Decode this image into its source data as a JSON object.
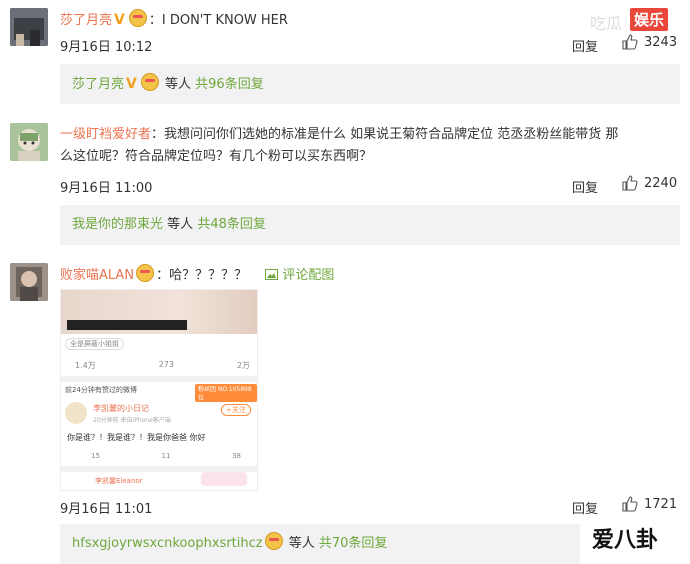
{
  "watermark_top": {
    "text": "娱乐",
    "faint": "吃瓜"
  },
  "watermark_bottom": {
    "text": "爱八卦"
  },
  "comments": [
    {
      "user": "莎了月亮",
      "text": "：I DON'T KNOW HER",
      "time": "9月16日 10:12",
      "reply_label": "回复",
      "likes": "3243",
      "replies": {
        "user": "莎了月亮",
        "suffix": "等人",
        "count_text": "共96条回复"
      }
    },
    {
      "user": "一级盯裆爱好者",
      "text_line1": "：我想问问你们选她的标准是什么 如果说王菊符合品牌定位 范丞丞粉丝能带货 那",
      "text_line2": "么这位呢？符合品牌定位吗？有几个粉可以买东西啊？",
      "time": "9月16日 11:00",
      "reply_label": "回复",
      "likes": "2240",
      "replies": {
        "user": "我是你的那束光",
        "suffix": "等人",
        "count_text": "共48条回复"
      }
    },
    {
      "user": "败家喵ALAN",
      "text": "：哈？？？？？",
      "image_link": "评论配图",
      "time": "9月16日 11:01",
      "reply_label": "回复",
      "likes": "1721",
      "replies": {
        "user": "hfsxgjoyrwsxcnkoophxsrtihcz",
        "suffix": "等人",
        "count_text": "共70条回复"
      }
    }
  ],
  "embedded_post": {
    "tag": "全是屏蔽小姐姐",
    "reposts": "1.4万",
    "comments": "273",
    "likes": "2万",
    "header": "前24分钟有赞过的微博",
    "badge": "粉丝团 NO.105898位",
    "commenter": "李凯馨的小日记",
    "commenter_sub": "20分钟前 来自iPhone客户端",
    "follow": "+关注",
    "body": "你是谁？！我是谁？！我是你爸爸 你好",
    "c_reposts": "15",
    "c_comments": "11",
    "c_likes": "38",
    "bottom_user": "李凯馨Eleanor"
  }
}
